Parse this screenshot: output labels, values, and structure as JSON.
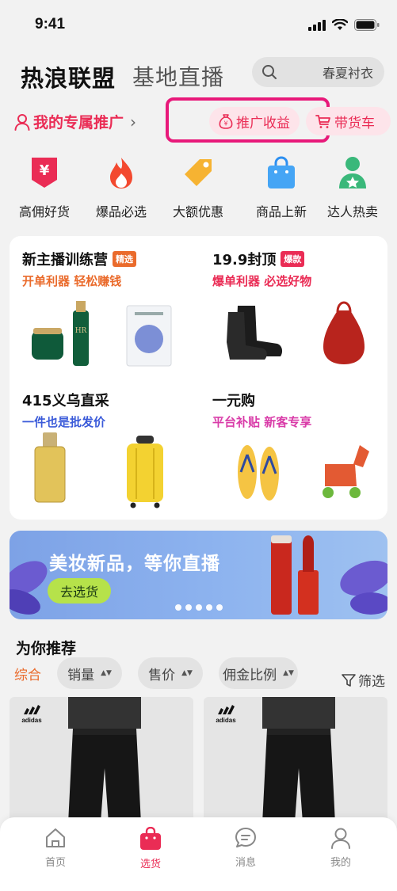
{
  "status": {
    "time": "9:41"
  },
  "header": {
    "tab_active": "热浪联盟",
    "tab_other": "基地直播",
    "search_placeholder": "春夏衬衣"
  },
  "promo": {
    "my_promotion": "我的专属推广",
    "earnings": "推广收益",
    "cart": "带货车"
  },
  "categories": [
    {
      "label": "高佣好货",
      "icon": "yen-tag-icon"
    },
    {
      "label": "爆品必选",
      "icon": "fire-icon"
    },
    {
      "label": "大额优惠",
      "icon": "price-tag-icon"
    },
    {
      "label": "商品上新",
      "icon": "shopping-bag-icon"
    },
    {
      "label": "达人热卖",
      "icon": "star-user-icon"
    }
  ],
  "grid": [
    {
      "title": "新主播训练营",
      "tag": "精选",
      "subtitle": "开单利器 轻松赚钱",
      "tag_color": "#ea6b2c",
      "sub_color": "#ea6b2c"
    },
    {
      "title": "19.9封顶",
      "tag": "爆款",
      "subtitle": "爆单利器 必选好物",
      "tag_color": "#ea2c55",
      "sub_color": "#ea2c55"
    },
    {
      "title": "415义乌直采",
      "tag": "",
      "subtitle": "一件也是批发价",
      "tag_color": "",
      "sub_color": "#3b5bd9"
    },
    {
      "title": "一元购",
      "tag": "",
      "subtitle": "平台补贴 新客专享",
      "tag_color": "",
      "sub_color": "#d93ba8"
    }
  ],
  "banner": {
    "title": "美妆新品，等你直播",
    "button": "去选货"
  },
  "recommend": {
    "title": "为你推荐",
    "filter_all": "综合",
    "sort_sales": "销量",
    "sort_price": "售价",
    "sort_commission": "佣金比例",
    "filter": "筛选"
  },
  "products": [
    {
      "brand": "adidas"
    },
    {
      "brand": "adidas"
    }
  ],
  "tabbar": [
    {
      "label": "首页",
      "active": false
    },
    {
      "label": "选货",
      "active": true
    },
    {
      "label": "消息",
      "active": false
    },
    {
      "label": "我的",
      "active": false
    }
  ],
  "colors": {
    "accent": "#ea2c55",
    "highlight": "#e8197a",
    "orange": "#ea6b2c"
  }
}
